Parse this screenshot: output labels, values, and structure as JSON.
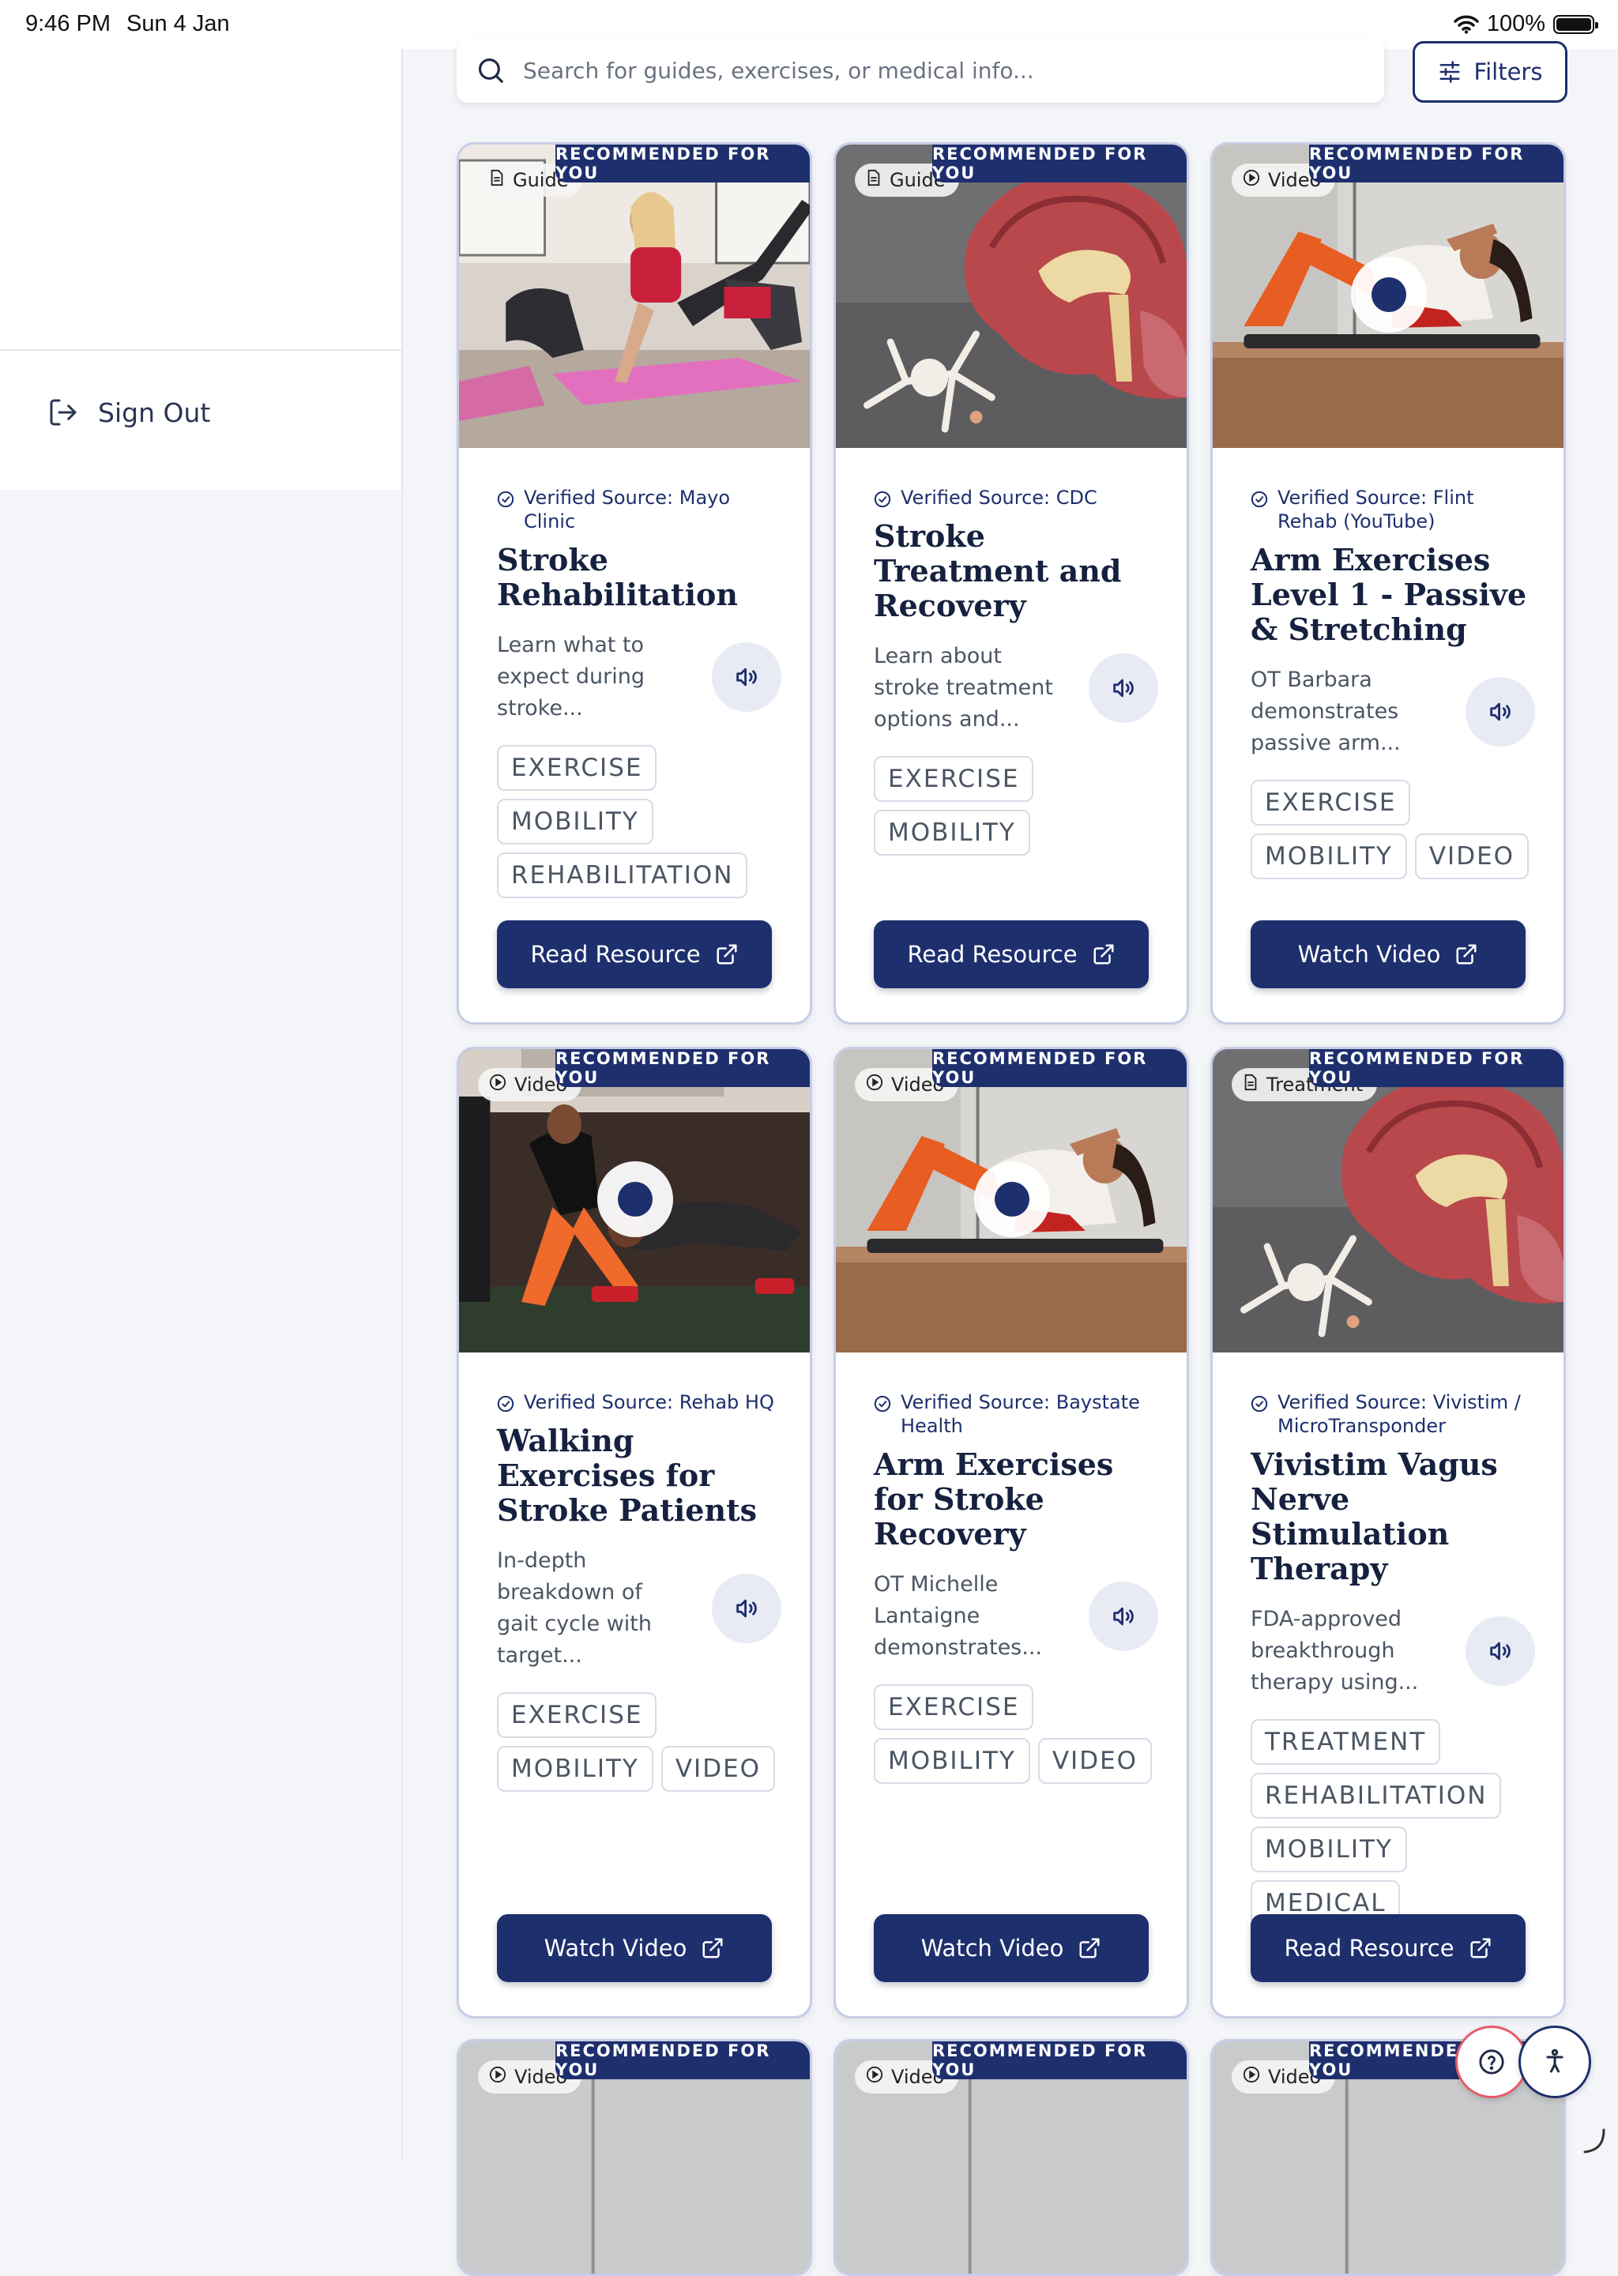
{
  "status_bar": {
    "time": "9:46 PM",
    "date": "Sun 4 Jan",
    "battery": "100%"
  },
  "sidebar": {
    "sign_out_label": "Sign Out"
  },
  "search": {
    "placeholder": "Search for guides, exercises, or medical info..."
  },
  "filters_label": "Filters",
  "colors": {
    "primary": "#1e2f6e",
    "help_accent": "#e55b6b",
    "card_border": "#c7cde6"
  },
  "cards": [
    {
      "type": "Guide",
      "badge": "RECOMMENDED FOR YOU",
      "source": "Verified Source: Mayo Clinic",
      "title": "Stroke Rehabilitation",
      "description": "Learn what to expect during stroke...",
      "tags": [
        "EXERCISE",
        "MOBILITY",
        "REHABILITATION"
      ],
      "action": "Read Resource",
      "image": "exercise-class-photo"
    },
    {
      "type": "Guide",
      "badge": "RECOMMENDED FOR YOU",
      "source": "Verified Source: CDC",
      "title": "Stroke Treatment and Recovery",
      "description": "Learn about stroke treatment options and...",
      "tags": [
        "EXERCISE",
        "MOBILITY"
      ],
      "action": "Read Resource",
      "image": "brain-model-photo"
    },
    {
      "type": "Video",
      "badge": "RECOMMENDED FOR YOU",
      "source": "Verified Source: Flint Rehab (YouTube)",
      "title": "Arm Exercises Level 1 - Passive & Stretching",
      "description": "OT Barbara demonstrates passive arm...",
      "tags": [
        "EXERCISE",
        "MOBILITY",
        "VIDEO"
      ],
      "action": "Watch Video",
      "image": "floor-exercise-photo"
    },
    {
      "type": "Video",
      "badge": "RECOMMENDED FOR YOU",
      "source": "Verified Source: Rehab HQ",
      "title": "Walking Exercises for Stroke Patients",
      "description": "In-depth breakdown of gait cycle with target...",
      "tags": [
        "EXERCISE",
        "MOBILITY",
        "VIDEO"
      ],
      "action": "Watch Video",
      "image": "gym-training-photo"
    },
    {
      "type": "Video",
      "badge": "RECOMMENDED FOR YOU",
      "source": "Verified Source: Baystate Health",
      "title": "Arm Exercises for Stroke Recovery",
      "description": "OT Michelle Lantaigne demonstrates...",
      "tags": [
        "EXERCISE",
        "MOBILITY",
        "VIDEO"
      ],
      "action": "Watch Video",
      "image": "floor-exercise-photo"
    },
    {
      "type": "Treatment",
      "badge": "RECOMMENDED FOR YOU",
      "source": "Verified Source: Vivistim / MicroTransponder",
      "title": "Vivistim Vagus Nerve Stimulation Therapy",
      "description": "FDA-approved breakthrough therapy using...",
      "tags": [
        "TREATMENT",
        "REHABILITATION",
        "MOBILITY",
        "MEDICAL"
      ],
      "action": "Read Resource",
      "image": "brain-model-photo"
    },
    {
      "type": "Video",
      "badge": "RECOMMENDED FOR YOU"
    },
    {
      "type": "Video",
      "badge": "RECOMMENDED FOR YOU"
    },
    {
      "type": "Video",
      "badge": "RECOMMENDED FOR YOU"
    }
  ],
  "icons": {
    "search": "search-icon",
    "filters": "sliders-icon",
    "sign_out": "sign-out-icon",
    "guide": "document-icon",
    "video": "play-circle-icon",
    "verified": "check-circle-icon",
    "audio": "speaker-icon",
    "external": "external-link-icon",
    "help": "help-icon",
    "accessibility": "accessibility-icon"
  }
}
